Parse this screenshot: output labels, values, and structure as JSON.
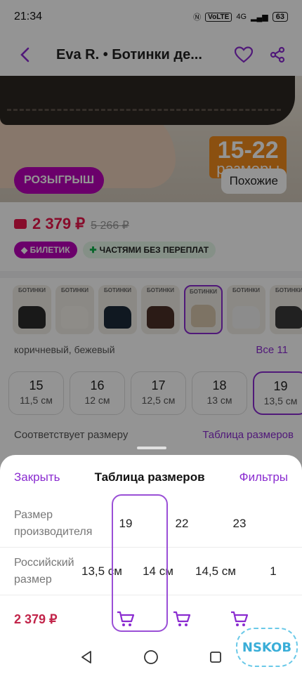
{
  "status_bar": {
    "time": "21:34",
    "volte": "VoLTE",
    "network": "4G",
    "battery": "63"
  },
  "header": {
    "title": "Eva R. • Ботинки де..."
  },
  "hero": {
    "promo_number": "15-22",
    "promo_word": "размеры",
    "raffle_label": "РОЗЫГРЫШ",
    "similar_label": "Похожие"
  },
  "price": {
    "current": "2 379 ₽",
    "old": "5 266 ₽"
  },
  "badges": {
    "ticket": "БИЛЕТИК",
    "installments": "ЧАСТЯМИ БЕЗ ПЕРЕПЛАТ"
  },
  "colors": {
    "thumb_label": "БОТИНКИ",
    "thumbs": [
      {
        "bg": "#2b2b2b"
      },
      {
        "bg": "#f4f1ea"
      },
      {
        "bg": "#1d2a3a"
      },
      {
        "bg": "#4a3026"
      },
      {
        "bg": "#d8c7ad",
        "selected": true
      },
      {
        "bg": "#f2f2f2"
      },
      {
        "bg": "#3a3a3a"
      }
    ],
    "selected_name": "коричневый, бежевый",
    "all_label": "Все 11"
  },
  "sizes": {
    "items": [
      {
        "size": "15",
        "cm": "11,5 см"
      },
      {
        "size": "16",
        "cm": "12 см"
      },
      {
        "size": "17",
        "cm": "12,5 см"
      },
      {
        "size": "18",
        "cm": "13 см"
      },
      {
        "size": "19",
        "cm": "13,5 см",
        "selected": true
      }
    ],
    "fit_label": "Соответствует размеру",
    "table_label": "Таблица размеров"
  },
  "sheet": {
    "close_label": "Закрыть",
    "title": "Таблица размеров",
    "filters_label": "Фильтры",
    "row_manufacturer_label": "Размер производителя",
    "row_russian_label": "Российский размер",
    "price_label": "2 379 ₽",
    "columns": [
      {
        "maker": "19",
        "ru": "13,5 см"
      },
      {
        "maker": "22",
        "ru": "14 см"
      },
      {
        "maker": "23",
        "ru": "14,5 см"
      }
    ],
    "edge_ru": "1"
  },
  "watermark": "NSKOB",
  "colors_theme": {
    "accent": "#8a2bd0",
    "price": "#e8154a",
    "raffle": "#b800b8"
  }
}
